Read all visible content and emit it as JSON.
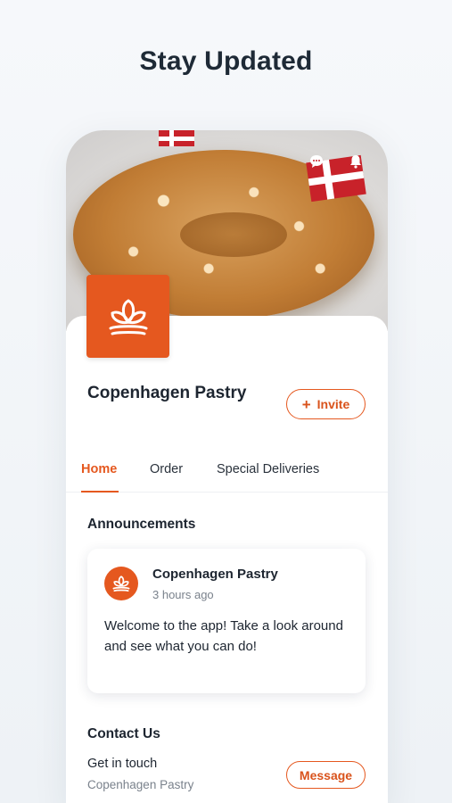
{
  "headline": "Stay Updated",
  "hero": {
    "photo": "danish-pastry-with-flags",
    "icons": [
      "chat-icon",
      "bell-icon"
    ]
  },
  "business": {
    "name": "Copenhagen Pastry",
    "logo": "pastry-logo-icon",
    "invite_label": "Invite",
    "invite_icon": "+"
  },
  "tabs": [
    {
      "label": "Home",
      "active": true
    },
    {
      "label": "Order",
      "active": false
    },
    {
      "label": "Special Deliveries",
      "active": false
    }
  ],
  "announcements": {
    "title": "Announcements",
    "post": {
      "author": "Copenhagen Pastry",
      "time": "3 hours ago",
      "body": "Welcome to the app! Take a look around and see what you can do!"
    }
  },
  "contact": {
    "title": "Contact Us",
    "line1": "Get in touch",
    "line2": "Copenhagen Pastry",
    "message_label": "Message"
  },
  "colors": {
    "accent": "#e5581f",
    "text": "#1d2530",
    "muted": "#7a828c"
  }
}
